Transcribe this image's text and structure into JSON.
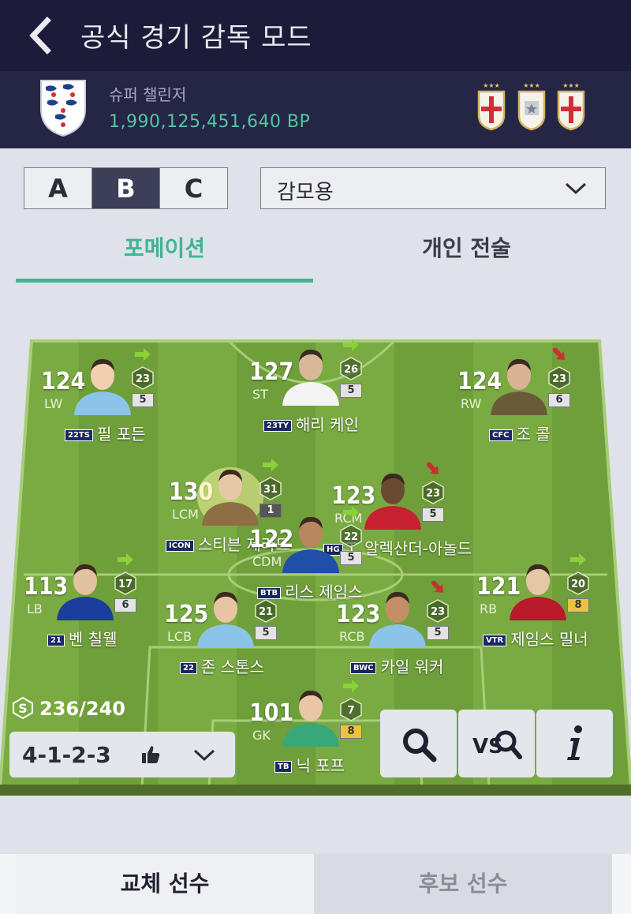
{
  "header": {
    "title": "공식 경기 감독 모드",
    "back_icon": "chevron-left-icon"
  },
  "profile": {
    "tier": "슈퍼 챌린저",
    "bp": "1,990,125,451,640 BP",
    "badges": [
      "england-cross-badge-icon",
      "silver-star-badge-icon",
      "england-cross-badge-icon"
    ]
  },
  "squad_tabs": {
    "items": [
      "A",
      "B",
      "C"
    ],
    "selected": "B"
  },
  "squad_select": {
    "value": "감모용"
  },
  "tabs": {
    "formation": "포메이션",
    "tactics": "개인 전술",
    "active": "포메이션"
  },
  "players": [
    {
      "id": "lw",
      "ovr": "124",
      "pos": "LW",
      "lvl": "23",
      "grade": "5",
      "name": "필 포든",
      "season": "22TS",
      "trend": "up"
    },
    {
      "id": "st",
      "ovr": "127",
      "pos": "ST",
      "lvl": "26",
      "grade": "5",
      "name": "해리 케인",
      "season": "23TY",
      "trend": "up"
    },
    {
      "id": "rw",
      "ovr": "124",
      "pos": "RW",
      "lvl": "23",
      "grade": "6",
      "name": "조 콜",
      "season": "CFC",
      "trend": "down"
    },
    {
      "id": "lcm",
      "ovr": "130",
      "pos": "LCM",
      "lvl": "31",
      "grade": "1",
      "name": "스티븐 제라드",
      "season": "ICON",
      "trend": "up"
    },
    {
      "id": "rcm",
      "ovr": "123",
      "pos": "RCM",
      "lvl": "23",
      "grade": "5",
      "name": "T. 알렉산더-아놀드",
      "season": "HG",
      "trend": "down"
    },
    {
      "id": "cdm",
      "ovr": "122",
      "pos": "CDM",
      "lvl": "22",
      "grade": "5",
      "name": "리스 제임스",
      "season": "BTB",
      "trend": "up"
    },
    {
      "id": "lb",
      "ovr": "113",
      "pos": "LB",
      "lvl": "17",
      "grade": "6",
      "name": "벤 칠웰",
      "season": "21",
      "trend": "up"
    },
    {
      "id": "lcb",
      "ovr": "125",
      "pos": "LCB",
      "lvl": "21",
      "grade": "5",
      "name": "존 스톤스",
      "season": "22",
      "trend": "none"
    },
    {
      "id": "rcb",
      "ovr": "123",
      "pos": "RCB",
      "lvl": "23",
      "grade": "5",
      "name": "카일 워커",
      "season": "BWC",
      "trend": "down"
    },
    {
      "id": "rb",
      "ovr": "121",
      "pos": "RB",
      "lvl": "20",
      "grade": "8",
      "name": "제임스 밀너",
      "season": "VTR",
      "trend": "up"
    },
    {
      "id": "gk",
      "ovr": "101",
      "pos": "GK",
      "lvl": "7",
      "grade": "8",
      "name": "닉 포프",
      "season": "TB",
      "trend": "up"
    }
  ],
  "salary": {
    "text": "236/240",
    "icon": "salary-s-icon"
  },
  "formation_select": {
    "value": "4-1-2-3",
    "thumb_icon": "thumbs-up-icon",
    "chevron": "chevron-down-icon"
  },
  "actions": {
    "search_icon": "search-icon",
    "vs_icon": "versus-search-icon",
    "info_icon": "info-icon"
  },
  "bottom_tabs": {
    "substitutes": "교체 선수",
    "reserves": "후보 선수",
    "active": "교체 선수"
  },
  "colors": {
    "topbar": "#1c1c3a",
    "profilebar": "#252545",
    "accent": "#3fb594",
    "pitch_light": "#7fb043",
    "pitch_dark": "#5f8a30",
    "bp_green": "#53c6a4",
    "trend_up": "#8ad13a",
    "trend_down": "#c8322d"
  }
}
